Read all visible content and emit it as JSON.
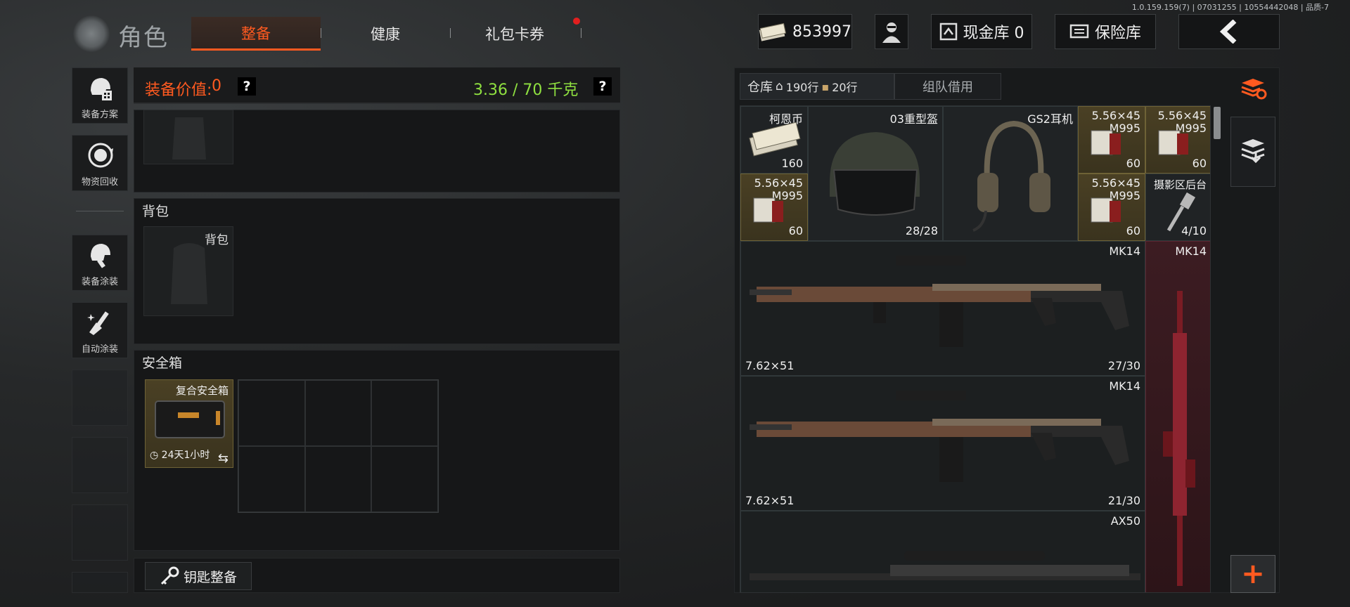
{
  "version": "1.0.159.159(7) | 07031255 | 10554442048 | 品质-7",
  "header": {
    "title": "角色",
    "tabs": [
      {
        "label": "整备",
        "active": true
      },
      {
        "label": "健康",
        "active": false
      },
      {
        "label": "礼包卡券",
        "active": false,
        "badge": true
      }
    ],
    "currency_value": "853997",
    "cash_vault_label": "现金库 0",
    "vault_label": "保险库"
  },
  "sidebar": {
    "items": [
      {
        "label": "装备方案",
        "icon": "helmet-plan-icon"
      },
      {
        "label": "物资回收",
        "icon": "recycle-icon"
      },
      {
        "label": "装备涂装",
        "icon": "paint-helmet-icon"
      },
      {
        "label": "自动涂装",
        "icon": "auto-paint-icon"
      }
    ]
  },
  "loadout": {
    "value_label": "装备价值:",
    "value": "0",
    "weight": "3.36 / 70 千克",
    "help": "?",
    "backpack_section": "背包",
    "backpack_slot_label": "背包",
    "safebox_section": "安全箱",
    "safebox_name": "复合安全箱",
    "safebox_time": "24天1小时",
    "key_button": "钥匙整备"
  },
  "warehouse": {
    "tab_main": "仓库",
    "rows_home": "190行",
    "rows_bag": "20行",
    "tab_team": "组队借用",
    "items": [
      {
        "name": "柯恩币",
        "count": "160"
      },
      {
        "name": "03重型盔",
        "count": "28/28"
      },
      {
        "name": "GS2耳机",
        "count": ""
      },
      {
        "name": "5.56×45\nM995",
        "count": "60"
      },
      {
        "name": "5.56×45\nM995",
        "count": "60"
      },
      {
        "name": "5.56×45\nM995",
        "count": "60"
      },
      {
        "name": "5.56×45\nM995",
        "count": "60"
      },
      {
        "name": "摄影区后台",
        "count": "4/10"
      },
      {
        "name": "MK14",
        "caliber": "7.62×51",
        "count": "27/30"
      },
      {
        "name": "MK14",
        "caliber": "7.62×51",
        "count": "21/30"
      },
      {
        "name": "MK14",
        "count": ""
      },
      {
        "name": "AX50",
        "count": ""
      }
    ]
  },
  "colors": {
    "accent": "#ff5a20",
    "weight": "#8fe040",
    "gold": "#4a4024",
    "red": "#3c1c22"
  }
}
